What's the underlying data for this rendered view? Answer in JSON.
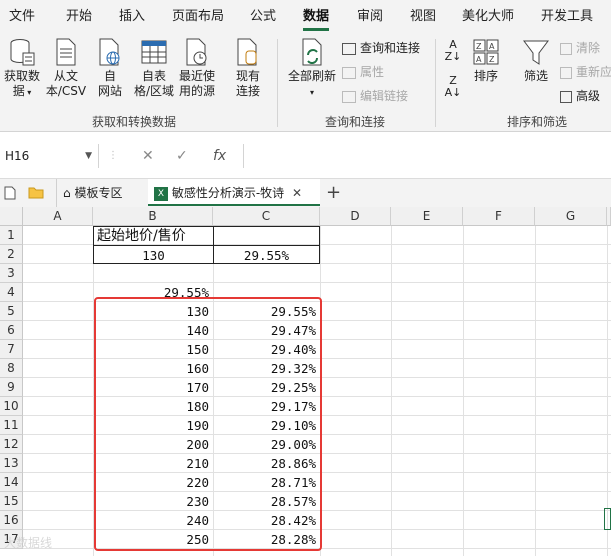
{
  "menu": [
    "文件",
    "开始",
    "插入",
    "页面布局",
    "公式",
    "数据",
    "审阅",
    "视图",
    "美化大师",
    "开发工具"
  ],
  "ribbon": {
    "get_data": "获取数",
    "get_data2": "据",
    "from_text": "从文",
    "from_text2": "本/CSV",
    "from_web": "自",
    "from_web2": "网站",
    "from_table": "自表",
    "from_table2": "格/区域",
    "recent": "最近使",
    "recent2": "用的源",
    "existing": "现有",
    "existing2": "连接",
    "group1": "获取和转换数据",
    "refresh_all": "全部刷新",
    "queries": "查询和连接",
    "properties": "属性",
    "edit_links": "编辑链接",
    "group2": "查询和连接",
    "sort": "排序",
    "filter": "筛选",
    "clear": "清除",
    "reapply": "重新应",
    "advanced": "高级",
    "group3": "排序和筛选"
  },
  "formula_bar": {
    "name_box": "H16",
    "cancel": "✕",
    "confirm": "✓",
    "fx": "fx",
    "formula": ""
  },
  "tabs": {
    "template": "模板专区",
    "sheet": "敏感性分析演示-牧诗",
    "add": "+"
  },
  "columns": [
    "A",
    "B",
    "C",
    "D",
    "E",
    "F",
    "G"
  ],
  "rows": [
    "1",
    "2",
    "3",
    "4",
    "5",
    "6",
    "7",
    "8",
    "9",
    "10",
    "11",
    "12",
    "13",
    "14",
    "15",
    "16",
    "17"
  ],
  "cells": {
    "b1": "起始地价/售价",
    "b2": "130",
    "c2": "29.55%",
    "b4": "29.55%"
  },
  "table": [
    {
      "price": "130",
      "rate": "29.55%"
    },
    {
      "price": "140",
      "rate": "29.47%"
    },
    {
      "price": "150",
      "rate": "29.40%"
    },
    {
      "price": "160",
      "rate": "29.32%"
    },
    {
      "price": "170",
      "rate": "29.25%"
    },
    {
      "price": "180",
      "rate": "29.17%"
    },
    {
      "price": "190",
      "rate": "29.10%"
    },
    {
      "price": "200",
      "rate": "29.00%"
    },
    {
      "price": "210",
      "rate": "28.86%"
    },
    {
      "price": "220",
      "rate": "28.71%"
    },
    {
      "price": "230",
      "rate": "28.57%"
    },
    {
      "price": "240",
      "rate": "28.42%"
    },
    {
      "price": "250",
      "rate": "28.28%"
    }
  ],
  "watermark": "大数据线",
  "colors": {
    "accent": "#217346",
    "highlight": "#e53935"
  }
}
